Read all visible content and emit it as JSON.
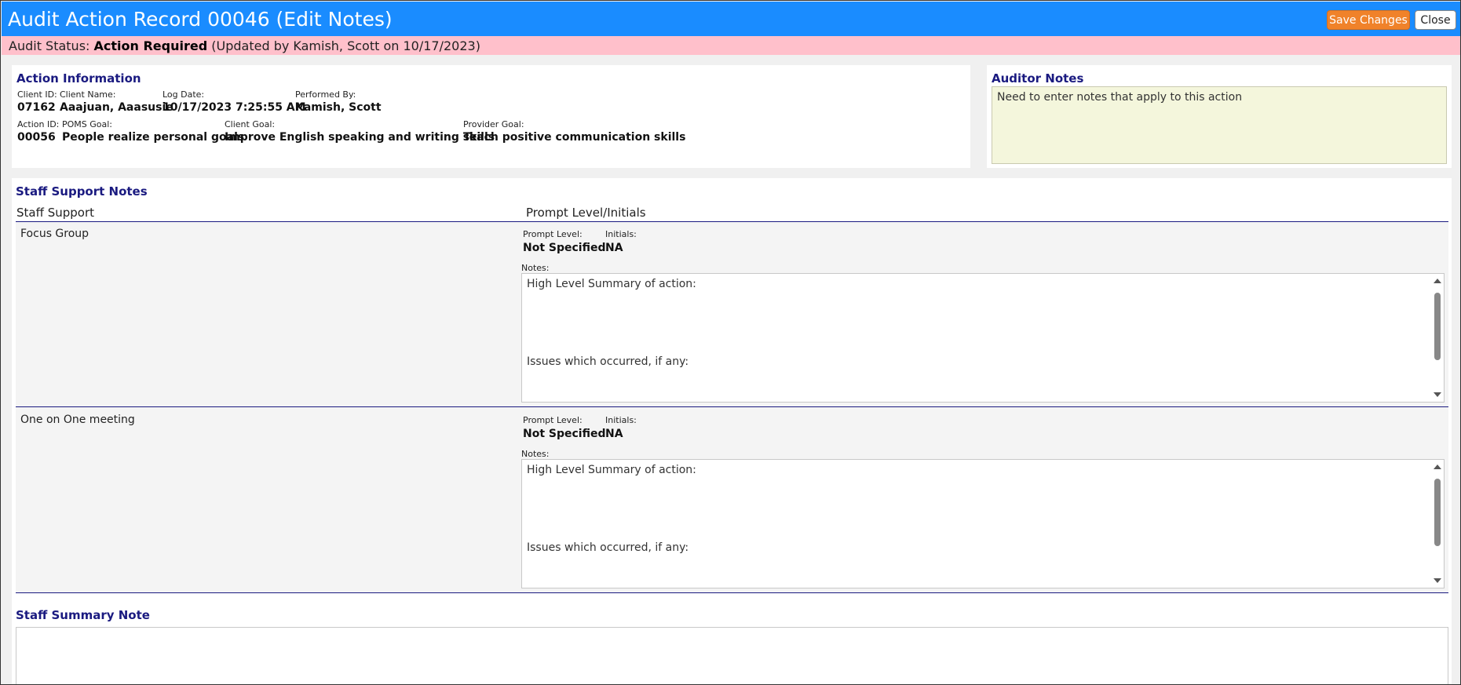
{
  "header": {
    "title": "Audit Action Record 00046 (Edit Notes)",
    "save_label": "Save Changes",
    "close_label": "Close"
  },
  "status": {
    "prefix": "Audit Status:",
    "value": "Action Required",
    "updated": "(Updated by Kamish, Scott on 10/17/2023)"
  },
  "action_info": {
    "title": "Action Information",
    "client_id_label": "Client ID:",
    "client_id": "07162",
    "client_name_label": "Client Name:",
    "client_name": "Aaajuan, Aaasusie",
    "log_date_label": "Log Date:",
    "log_date": "10/17/2023 7:25:55 AM",
    "performed_by_label": "Performed By:",
    "performed_by": "Kamish, Scott",
    "action_id_label": "Action ID:",
    "action_id": "00056",
    "poms_goal_label": "POMS Goal:",
    "poms_goal": "People realize personal goals",
    "client_goal_label": "Client Goal:",
    "client_goal": "Improve English speaking and writing skills",
    "provider_goal_label": "Provider Goal:",
    "provider_goal": "Teach positive communication skills"
  },
  "auditor_notes": {
    "title": "Auditor Notes",
    "text": "Need to enter notes that apply to this action"
  },
  "staff_support": {
    "title": "Staff Support Notes",
    "col_support": "Staff Support",
    "col_prompt": "Prompt Level/Initials",
    "rows": [
      {
        "name": "Focus Group",
        "prompt_level_label": "Prompt Level:",
        "prompt_level": "Not Specified",
        "initials_label": "Initials:",
        "initials": "NA",
        "notes_label": "Notes:",
        "notes_line1": "High Level Summary of action:",
        "notes_line2": "Issues which occurred, if any:"
      },
      {
        "name": "One on One meeting",
        "prompt_level_label": "Prompt Level:",
        "prompt_level": "Not Specified",
        "initials_label": "Initials:",
        "initials": "NA",
        "notes_label": "Notes:",
        "notes_line1": "High Level Summary of action:",
        "notes_line2": "Issues which occurred, if any:"
      }
    ]
  },
  "staff_summary": {
    "title": "Staff Summary Note",
    "text": ""
  },
  "colors": {
    "header_bg": "#1a8cff",
    "status_bg": "#ffc0cb",
    "save_button": "#f0822a",
    "section_title": "#1a1a80",
    "auditor_notes_bg": "#f4f6dc"
  }
}
